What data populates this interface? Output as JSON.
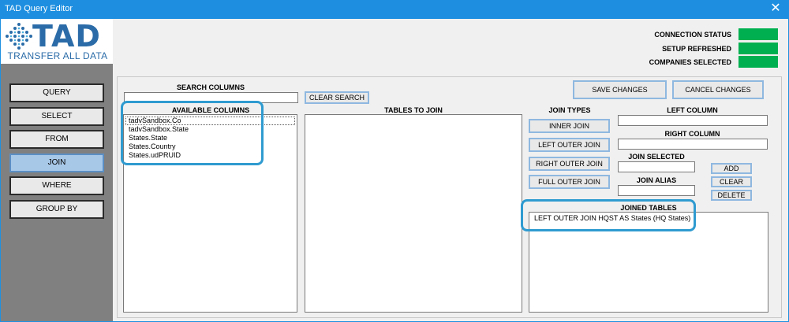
{
  "window": {
    "title": "TAD Query Editor",
    "close_glyph": "✕"
  },
  "logo": {
    "word": "TAD",
    "tagline": "TRANSFER ALL DATA"
  },
  "nav": [
    {
      "label": "QUERY"
    },
    {
      "label": "SELECT"
    },
    {
      "label": "FROM"
    },
    {
      "label": "JOIN",
      "active": true
    },
    {
      "label": "WHERE"
    },
    {
      "label": "GROUP BY"
    }
  ],
  "status": {
    "connection_label": "CONNECTION STATUS",
    "setup_label": "SETUP REFRESHED",
    "companies_label": "COMPANIES SELECTED",
    "ok_color": "#00b050"
  },
  "search": {
    "label": "SEARCH COLUMNS",
    "value": "",
    "clear_label": "CLEAR SEARCH"
  },
  "available": {
    "label": "AVAILABLE COLUMNS",
    "items": [
      "tadvSandbox.Co",
      "tadvSandbox.State",
      "States.State",
      "States.Country",
      "States.udPRUID"
    ]
  },
  "tables_to_join": {
    "label": "TABLES TO JOIN"
  },
  "actions": {
    "save_label": "SAVE CHANGES",
    "cancel_label": "CANCEL CHANGES"
  },
  "join_types": {
    "label": "JOIN TYPES",
    "inner": "INNER JOIN",
    "left_outer": "LEFT OUTER JOIN",
    "right_outer": "RIGHT OUTER JOIN",
    "full_outer": "FULL OUTER JOIN"
  },
  "join_fields": {
    "left_column_label": "LEFT COLUMN",
    "left_column_value": "",
    "right_column_label": "RIGHT COLUMN",
    "right_column_value": "",
    "join_selected_label": "JOIN SELECTED",
    "join_selected_value": "",
    "join_alias_label": "JOIN ALIAS",
    "join_alias_value": ""
  },
  "join_buttons": {
    "add": "ADD",
    "clear": "CLEAR",
    "delete": "DELETE"
  },
  "joined_tables": {
    "label": "JOINED TABLES",
    "items": [
      "LEFT OUTER JOIN HQST AS States (HQ States)"
    ]
  },
  "colors": {
    "accent": "#1e8fe0",
    "sidebar": "#808080",
    "callout": "#2f9bd0",
    "brand": "#2b6ca8"
  }
}
